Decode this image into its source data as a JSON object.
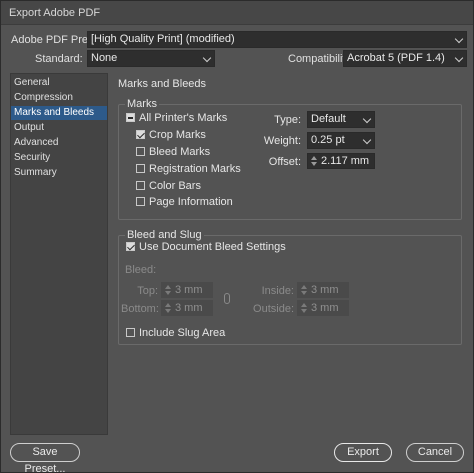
{
  "window": {
    "title": "Export Adobe PDF"
  },
  "header": {
    "preset_label": "Adobe PDF Preset:",
    "preset_value": "[High Quality Print] (modified)",
    "standard_label": "Standard:",
    "standard_value": "None",
    "compat_label": "Compatibility:",
    "compat_value": "Acrobat 5 (PDF 1.4)"
  },
  "sidebar": {
    "items": [
      {
        "label": "General"
      },
      {
        "label": "Compression"
      },
      {
        "label": "Marks and Bleeds"
      },
      {
        "label": "Output"
      },
      {
        "label": "Advanced"
      },
      {
        "label": "Security"
      },
      {
        "label": "Summary"
      }
    ],
    "selected": "Marks and Bleeds"
  },
  "main": {
    "section_title": "Marks and Bleeds",
    "marks": {
      "group_title": "Marks",
      "all_printers_marks": {
        "label": "All Printer's Marks",
        "state": "mixed"
      },
      "crop_marks": {
        "label": "Crop Marks",
        "checked": true
      },
      "bleed_marks": {
        "label": "Bleed Marks",
        "checked": false
      },
      "registration_marks": {
        "label": "Registration Marks",
        "checked": false
      },
      "color_bars": {
        "label": "Color Bars",
        "checked": false
      },
      "page_information": {
        "label": "Page Information",
        "checked": false
      },
      "type_label": "Type:",
      "type_value": "Default",
      "weight_label": "Weight:",
      "weight_value": "0.25 pt",
      "offset_label": "Offset:",
      "offset_value": "2.117 mm"
    },
    "bleed": {
      "group_title": "Bleed and Slug",
      "use_doc_bleed": {
        "label": "Use Document Bleed Settings",
        "checked": true
      },
      "bleed_label": "Bleed:",
      "top_label": "Top:",
      "top_value": "3 mm",
      "bottom_label": "Bottom:",
      "bottom_value": "3 mm",
      "inside_label": "Inside:",
      "inside_value": "3 mm",
      "outside_label": "Outside:",
      "outside_value": "3 mm",
      "include_slug": {
        "label": "Include Slug Area",
        "checked": false
      }
    }
  },
  "footer": {
    "save_preset": "Save Preset...",
    "export": "Export",
    "cancel": "Cancel"
  }
}
